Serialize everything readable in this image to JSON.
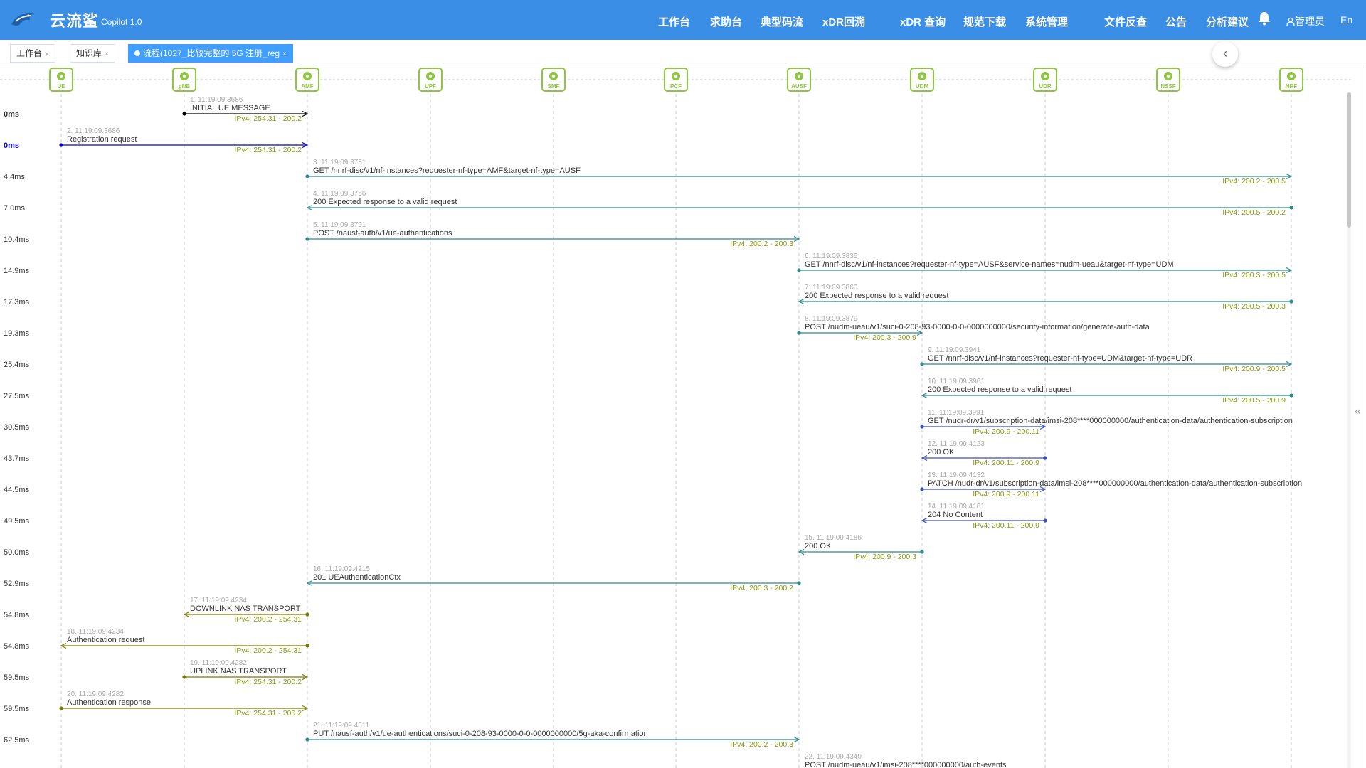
{
  "app": {
    "brand": "云流鲨",
    "version": "Copilot 1.0"
  },
  "nav": [
    {
      "label": "工作台",
      "name": "nav-workbench"
    },
    {
      "label": "求助台",
      "name": "nav-help"
    },
    {
      "label": "典型码流",
      "name": "nav-typical-streams"
    },
    {
      "label": "xDR回溯",
      "name": "nav-xdr-trace"
    },
    {
      "label": "xDR 查询",
      "name": "nav-xdr-query"
    },
    {
      "label": "规范下载",
      "name": "nav-spec-download"
    },
    {
      "label": "系统管理",
      "name": "nav-system"
    },
    {
      "label": "文件反查",
      "name": "nav-file-lookup"
    },
    {
      "label": "公告",
      "name": "nav-notice"
    },
    {
      "label": "分析建议",
      "name": "nav-analysis"
    }
  ],
  "user": {
    "label": "管理员",
    "lang": "En",
    "bell_icon": "bell-icon",
    "user_icon": "user-icon"
  },
  "tabs": [
    {
      "label": "工作台",
      "close": "×",
      "active": false
    },
    {
      "label": "知识库",
      "close": "×",
      "active": false
    },
    {
      "label": "流程(1027_比较完整的 5G 注册_reg",
      "close": "×",
      "active": true
    }
  ],
  "collapse_icon": "chevron-left-icon",
  "right_handle": "«",
  "colors": {
    "header": "#3a8ee6",
    "node": "#8dc63f",
    "ipv4_text": "#8a9b10",
    "black": "#000000",
    "blue": "#0000cc",
    "teal": "#2b8a8a",
    "indigo": "#3a4fc1",
    "olive": "#7a7a00"
  },
  "nodes": [
    {
      "label": "UE",
      "icon": "phone-icon"
    },
    {
      "label": "gNB",
      "icon": "antenna-icon"
    },
    {
      "label": "AMF",
      "icon": "gear-icon"
    },
    {
      "label": "UPF",
      "icon": "gear-icon"
    },
    {
      "label": "SMF",
      "icon": "gear-icon"
    },
    {
      "label": "PCF",
      "icon": "flow-icon"
    },
    {
      "label": "AUSF",
      "icon": "database-icon"
    },
    {
      "label": "UDM",
      "icon": "database-icon"
    },
    {
      "label": "UDR",
      "icon": "database-icon"
    },
    {
      "label": "NSSF",
      "icon": "database-icon"
    },
    {
      "label": "NRF",
      "icon": "database-icon"
    }
  ],
  "messages": [
    {
      "time": "0ms",
      "seq": "1. 11:19:09.3686",
      "text": "INITIAL UE MESSAGE",
      "ip": "IPv4: 254.31 - 200.2",
      "from": 1,
      "to": 2,
      "color": "black"
    },
    {
      "time": "0ms",
      "seq": "2. 11:19:09.3686",
      "text": "Registration request",
      "ip": "IPv4: 254.31 - 200.2",
      "from": 0,
      "to": 2,
      "color": "blue"
    },
    {
      "time": "4.4ms",
      "seq": "3. 11:19:09.3731",
      "text": "GET /nnrf-disc/v1/nf-instances?requester-nf-type=AMF&target-nf-type=AUSF",
      "ip": "IPv4: 200.2 - 200.5",
      "from": 2,
      "to": 10,
      "color": "teal"
    },
    {
      "time": "7.0ms",
      "seq": "4. 11:19:09.3756",
      "text": "200 Expected response to a valid request",
      "ip": "IPv4: 200.5 - 200.2",
      "from": 10,
      "to": 2,
      "color": "teal"
    },
    {
      "time": "10.4ms",
      "seq": "5. 11:19:09.3791",
      "text": "POST /nausf-auth/v1/ue-authentications",
      "ip": "IPv4: 200.2 - 200.3",
      "from": 2,
      "to": 6,
      "color": "teal"
    },
    {
      "time": "14.9ms",
      "seq": "6. 11:19:09.3836",
      "text": "GET /nnrf-disc/v1/nf-instances?requester-nf-type=AUSF&service-names=nudm-ueau&target-nf-type=UDM",
      "ip": "IPv4: 200.3 - 200.5",
      "from": 6,
      "to": 10,
      "color": "teal"
    },
    {
      "time": "17.3ms",
      "seq": "7. 11:19:09.3860",
      "text": "200 Expected response to a valid request",
      "ip": "IPv4: 200.5 - 200.3",
      "from": 10,
      "to": 6,
      "color": "teal"
    },
    {
      "time": "19.3ms",
      "seq": "8. 11:19:09.3879",
      "text": "POST /nudm-ueau/v1/suci-0-208-93-0000-0-0-0000000000/security-information/generate-auth-data",
      "ip": "IPv4: 200.3 - 200.9",
      "from": 6,
      "to": 7,
      "color": "teal"
    },
    {
      "time": "25.4ms",
      "seq": "9. 11:19:09.3941",
      "text": "GET /nnrf-disc/v1/nf-instances?requester-nf-type=UDM&target-nf-type=UDR",
      "ip": "IPv4: 200.9 - 200.5",
      "from": 7,
      "to": 10,
      "color": "teal"
    },
    {
      "time": "27.5ms",
      "seq": "10. 11:19:09.3961",
      "text": "200 Expected response to a valid request",
      "ip": "IPv4: 200.5 - 200.9",
      "from": 10,
      "to": 7,
      "color": "teal"
    },
    {
      "time": "30.5ms",
      "seq": "11. 11:19:09.3991",
      "text": "GET /nudr-dr/v1/subscription-data/imsi-208****000000000/authentication-data/authentication-subscription",
      "ip": "IPv4: 200.9 - 200.11",
      "from": 7,
      "to": 8,
      "color": "indigo"
    },
    {
      "time": "43.7ms",
      "seq": "12. 11:19:09.4123",
      "text": "200 OK",
      "ip": "IPv4: 200.11 - 200.9",
      "from": 8,
      "to": 7,
      "color": "indigo"
    },
    {
      "time": "44.5ms",
      "seq": "13. 11:19:09.4132",
      "text": "PATCH /nudr-dr/v1/subscription-data/imsi-208****000000000/authentication-data/authentication-subscription",
      "ip": "IPv4: 200.9 - 200.11",
      "from": 7,
      "to": 8,
      "color": "indigo"
    },
    {
      "time": "49.5ms",
      "seq": "14. 11:19:09.4181",
      "text": "204 No Content",
      "ip": "IPv4: 200.11 - 200.9",
      "from": 8,
      "to": 7,
      "color": "indigo"
    },
    {
      "time": "50.0ms",
      "seq": "15. 11:19:09.4186",
      "text": "200 OK",
      "ip": "IPv4: 200.9 - 200.3",
      "from": 7,
      "to": 6,
      "color": "teal"
    },
    {
      "time": "52.9ms",
      "seq": "16. 11:19:09.4215",
      "text": "201 UEAuthenticationCtx",
      "ip": "IPv4: 200.3 - 200.2",
      "from": 6,
      "to": 2,
      "color": "teal"
    },
    {
      "time": "54.8ms",
      "seq": "17. 11:19:09.4234",
      "text": "DOWNLINK NAS TRANSPORT",
      "ip": "IPv4: 200.2 - 254.31",
      "from": 2,
      "to": 1,
      "color": "olive"
    },
    {
      "time": "54.8ms",
      "seq": "18. 11:19:09.4234",
      "text": "Authentication request",
      "ip": "IPv4: 200.2 - 254.31",
      "from": 2,
      "to": 0,
      "color": "olive"
    },
    {
      "time": "59.5ms",
      "seq": "19. 11:19:09.4282",
      "text": "UPLINK NAS TRANSPORT",
      "ip": "IPv4: 254.31 - 200.2",
      "from": 1,
      "to": 2,
      "color": "olive"
    },
    {
      "time": "59.5ms",
      "seq": "20. 11:19:09.4282",
      "text": "Authentication response",
      "ip": "IPv4: 254.31 - 200.2",
      "from": 0,
      "to": 2,
      "color": "olive"
    },
    {
      "time": "62.5ms",
      "seq": "21. 11:19:09.4311",
      "text": "PUT /nausf-auth/v1/ue-authentications/suci-0-208-93-0000-0-0-0000000000/5g-aka-confirmation",
      "ip": "IPv4: 200.2 - 200.3",
      "from": 2,
      "to": 6,
      "color": "teal"
    },
    {
      "time": "",
      "seq": "22. 11:19:09.4340",
      "text": "POST /nudm-ueau/v1/imsi-208****000000000/auth-events",
      "ip": "",
      "from": 6,
      "to": 7,
      "color": "teal"
    }
  ]
}
